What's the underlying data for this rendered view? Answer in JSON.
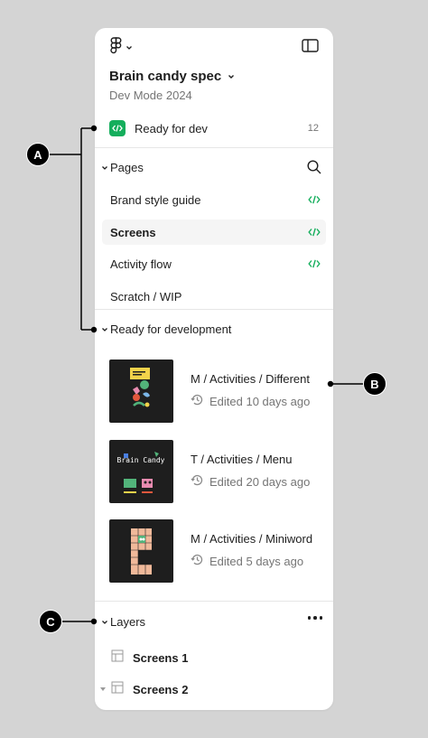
{
  "header": {
    "file_title": "Brain candy spec",
    "file_subtitle": "Dev Mode 2024"
  },
  "ready_for_dev": {
    "label": "Ready for dev",
    "count": "12"
  },
  "pages": {
    "title": "Pages",
    "items": [
      {
        "label": "Brand style guide",
        "ready": true,
        "selected": false
      },
      {
        "label": "Screens",
        "ready": true,
        "selected": true
      },
      {
        "label": "Activity flow",
        "ready": true,
        "selected": false
      },
      {
        "label": "Scratch / WIP",
        "ready": false,
        "selected": false
      }
    ]
  },
  "ready_section": {
    "title": "Ready for development",
    "frames": [
      {
        "name": "M / Activities / Different",
        "edited": "Edited 10 days ago"
      },
      {
        "name": "T / Activities / Menu",
        "edited": "Edited 20 days ago"
      },
      {
        "name": "M / Activities / Miniword",
        "edited": "Edited 5 days ago"
      }
    ]
  },
  "layers": {
    "title": "Layers",
    "items": [
      {
        "label": "Screens 1"
      },
      {
        "label": "Screens 2"
      }
    ]
  },
  "annotations": {
    "a": "A",
    "b": "B",
    "c": "C"
  },
  "thumbnail_text": {
    "brain_candy": "Brain Candy"
  },
  "colors": {
    "background": "#d4d4d4",
    "panel": "#ffffff",
    "dev_green": "#14ae5c",
    "thumb_bg": "#1e1e1e",
    "selected_bg": "#f5f5f5",
    "muted_text": "#757575"
  },
  "icons": {
    "logo": "figma-logo-icon",
    "sidebar": "sidebar-toggle-icon",
    "search": "search-icon",
    "dev": "code-brackets-icon",
    "history": "history-icon",
    "more": "more-horizontal-icon",
    "frame": "frame-icon"
  }
}
